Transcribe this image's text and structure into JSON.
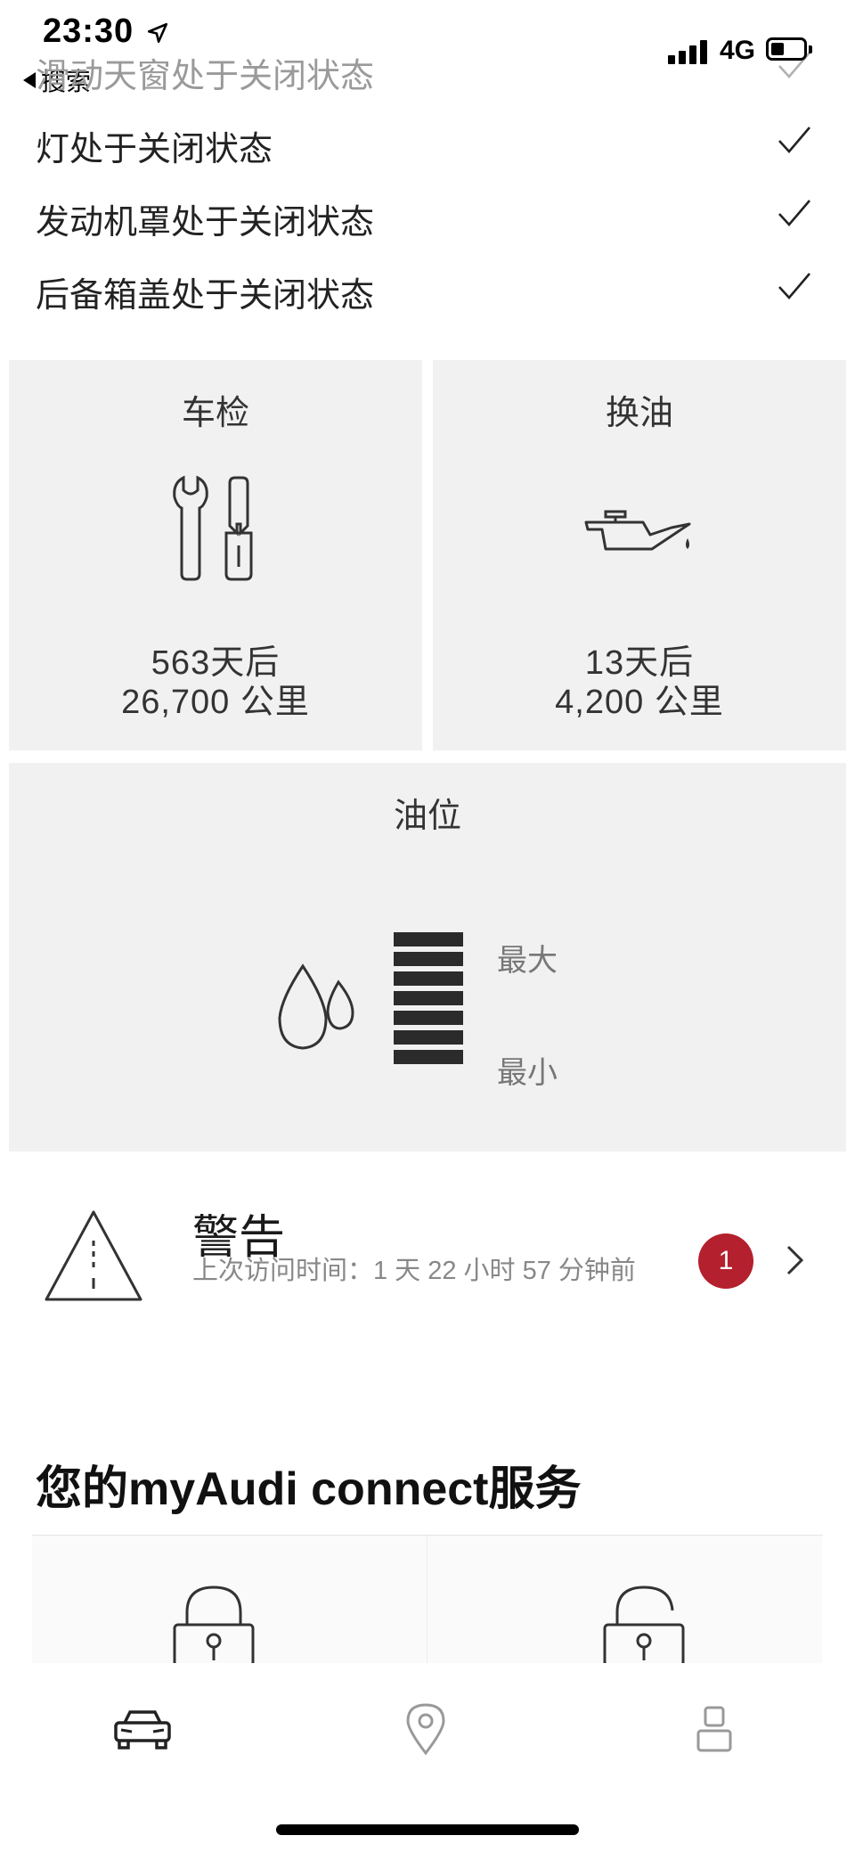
{
  "status_bar": {
    "time": "23:30",
    "back_label": "搜索",
    "network": "4G"
  },
  "vehicle_status": {
    "items": [
      {
        "label": "滑动天窗处于关闭状态",
        "ok": true
      },
      {
        "label": "灯处于关闭状态",
        "ok": true
      },
      {
        "label": "发动机罩处于关闭状态",
        "ok": true
      },
      {
        "label": "后备箱盖处于关闭状态",
        "ok": true
      }
    ]
  },
  "inspection": {
    "title": "车检",
    "days": "563天后",
    "distance": "26,700 公里"
  },
  "oil_change": {
    "title": "换油",
    "days": "13天后",
    "distance": "4,200 公里"
  },
  "oil_level": {
    "title": "油位",
    "max_label": "最大",
    "min_label": "最小",
    "filled_segments": 7,
    "total_segments": 7
  },
  "warnings": {
    "title": "警告",
    "subtitle": "上次访问时间：1 天 22 小时 57 分钟前",
    "count": "1",
    "badge_color": "#b4202d"
  },
  "services": {
    "heading": "您的myAudi connect服务",
    "items": [
      {
        "icon": "lock-closed-icon"
      },
      {
        "icon": "lock-open-icon"
      }
    ]
  },
  "tab_bar": {
    "items": [
      {
        "icon": "car-icon",
        "active": true
      },
      {
        "icon": "location-pin-icon",
        "active": false
      },
      {
        "icon": "profile-icon",
        "active": false
      }
    ]
  }
}
